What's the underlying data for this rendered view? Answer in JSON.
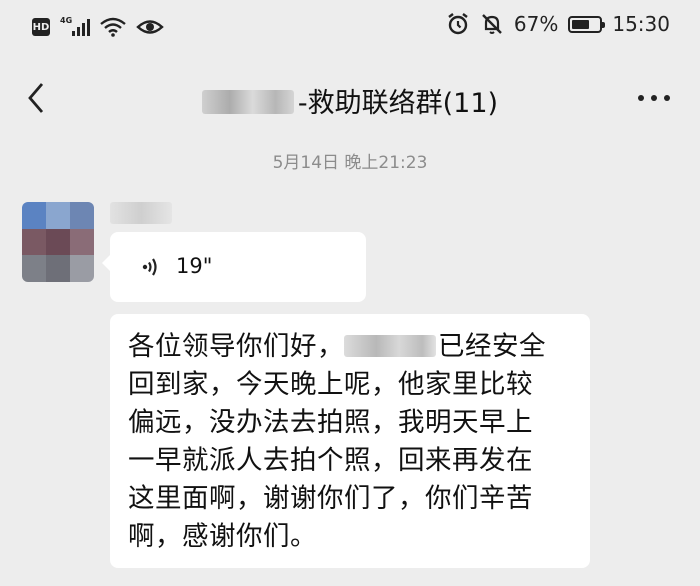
{
  "status_bar": {
    "hd": "HD",
    "network": "4G",
    "battery_percent": "67%",
    "battery_level": 0.67,
    "time": "15:30",
    "icons": [
      "hd-icon",
      "signal-icon",
      "wifi-icon",
      "eye-icon",
      "alarm-icon",
      "bell-muted-icon",
      "battery-icon"
    ]
  },
  "header": {
    "title_suffix": "-救助联络群(11)",
    "back_icon": "chevron-left-icon",
    "more_icon": "more-dots-icon"
  },
  "chat": {
    "timestamp": "5月14日 晚上21:23",
    "voice_message": {
      "duration": "19\"",
      "icon": "voice-wave-icon"
    },
    "text_message": {
      "line1_before": "各位领导你们好，",
      "line1_after": "已经安全",
      "line2": "回到家，今天晚上呢，他家里比较",
      "line3": "偏远，没办法去拍照，我明天早上",
      "line4": "一早就派人去拍个照，回来再发在",
      "line5": "这里面啊，谢谢你们了，你们辛苦",
      "line6": "啊，感谢你们。"
    }
  },
  "colors": {
    "background": "#ededed",
    "bubble": "#ffffff",
    "text": "#111111",
    "timestamp": "#8c8c8c"
  }
}
